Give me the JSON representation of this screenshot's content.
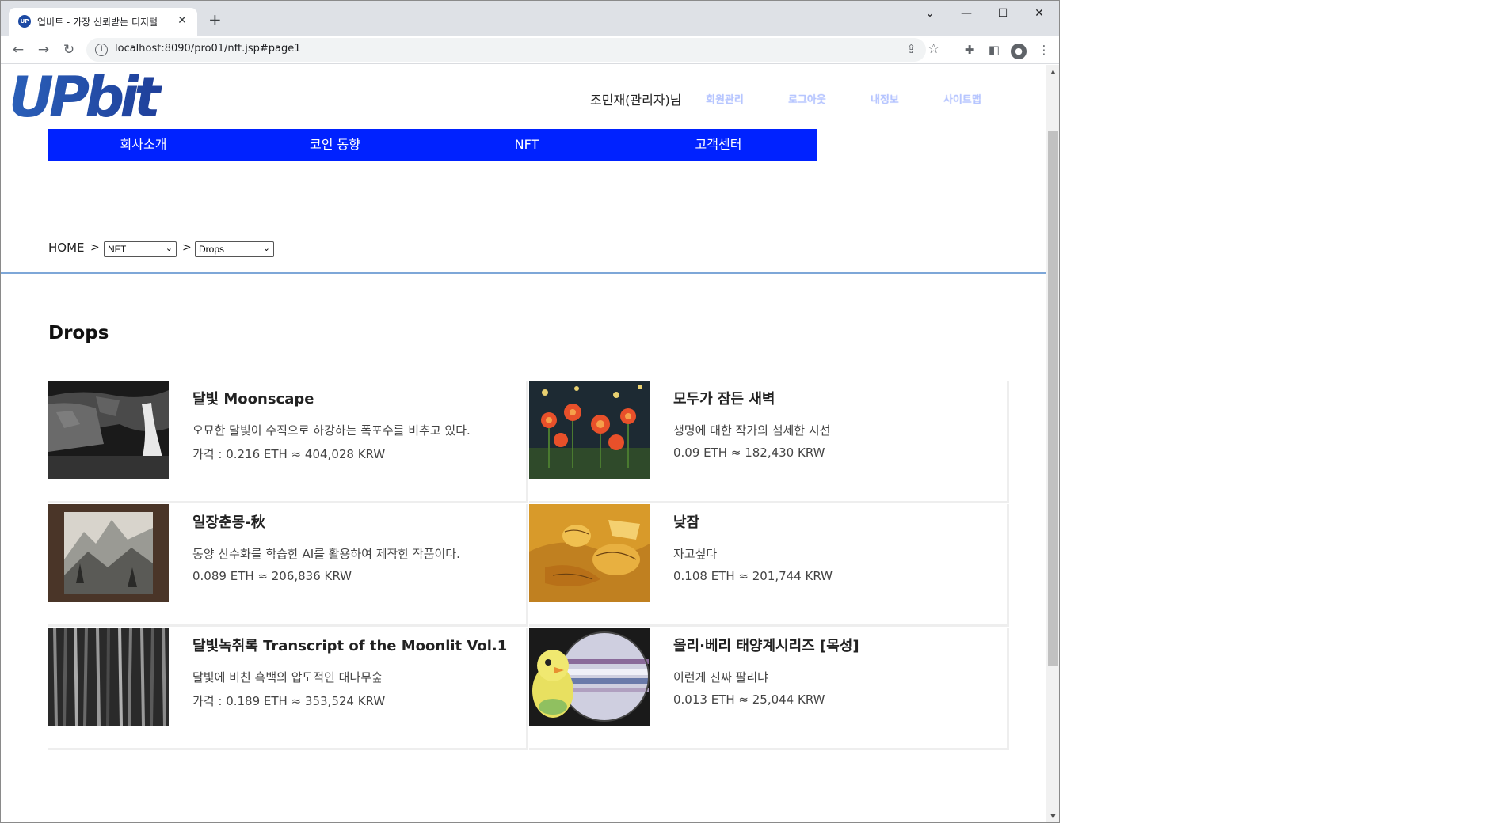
{
  "browser": {
    "tab_title": "업비트 - 가장 신뢰받는 디지털",
    "favicon_text": "UP",
    "url": "localhost:8090/pro01/nft.jsp#page1"
  },
  "header": {
    "user_name": "조민재(관리자)님",
    "util_links": [
      "회원관리",
      "로그아웃",
      "내정보",
      "사이트맵"
    ]
  },
  "nav": {
    "items": [
      "회사소개",
      "코인 동향",
      "NFT",
      "고객센터"
    ],
    "background": "#0022ff"
  },
  "breadcrumb": {
    "home": "HOME",
    "separator": ">",
    "select1": "NFT",
    "select2": "Drops"
  },
  "section": {
    "title": "Drops"
  },
  "cards": [
    {
      "title": "달빛 Moonscape",
      "desc": "오묘한 달빛이 수직으로 하강하는 폭포수를 비추고 있다.",
      "price": "가격 : 0.216 ETH ≈ 404,028 KRW"
    },
    {
      "title": "모두가 잠든 새벽",
      "desc": "생명에 대한 작가의 섬세한 시선",
      "price": "0.09 ETH ≈ 182,430 KRW"
    },
    {
      "title": "일장춘몽-秋",
      "desc": "동양 산수화를 학습한 AI를 활용하여 제작한 작품이다.",
      "price": "0.089 ETH ≈ 206,836 KRW"
    },
    {
      "title": "낮잠",
      "desc": "자고싶다",
      "price": "0.108 ETH ≈ 201,744 KRW"
    },
    {
      "title": "달빛녹취록 Transcript of the Moonlit Vol.1",
      "desc": "달빛에 비친 흑백의 압도적인 대나무숲",
      "price": "가격 : 0.189 ETH ≈ 353,524 KRW"
    },
    {
      "title": "올리·베리 태양계시리즈 [목성]",
      "desc": "이런게 진짜 팔리냐",
      "price": "0.013 ETH ≈ 25,044 KRW"
    }
  ]
}
